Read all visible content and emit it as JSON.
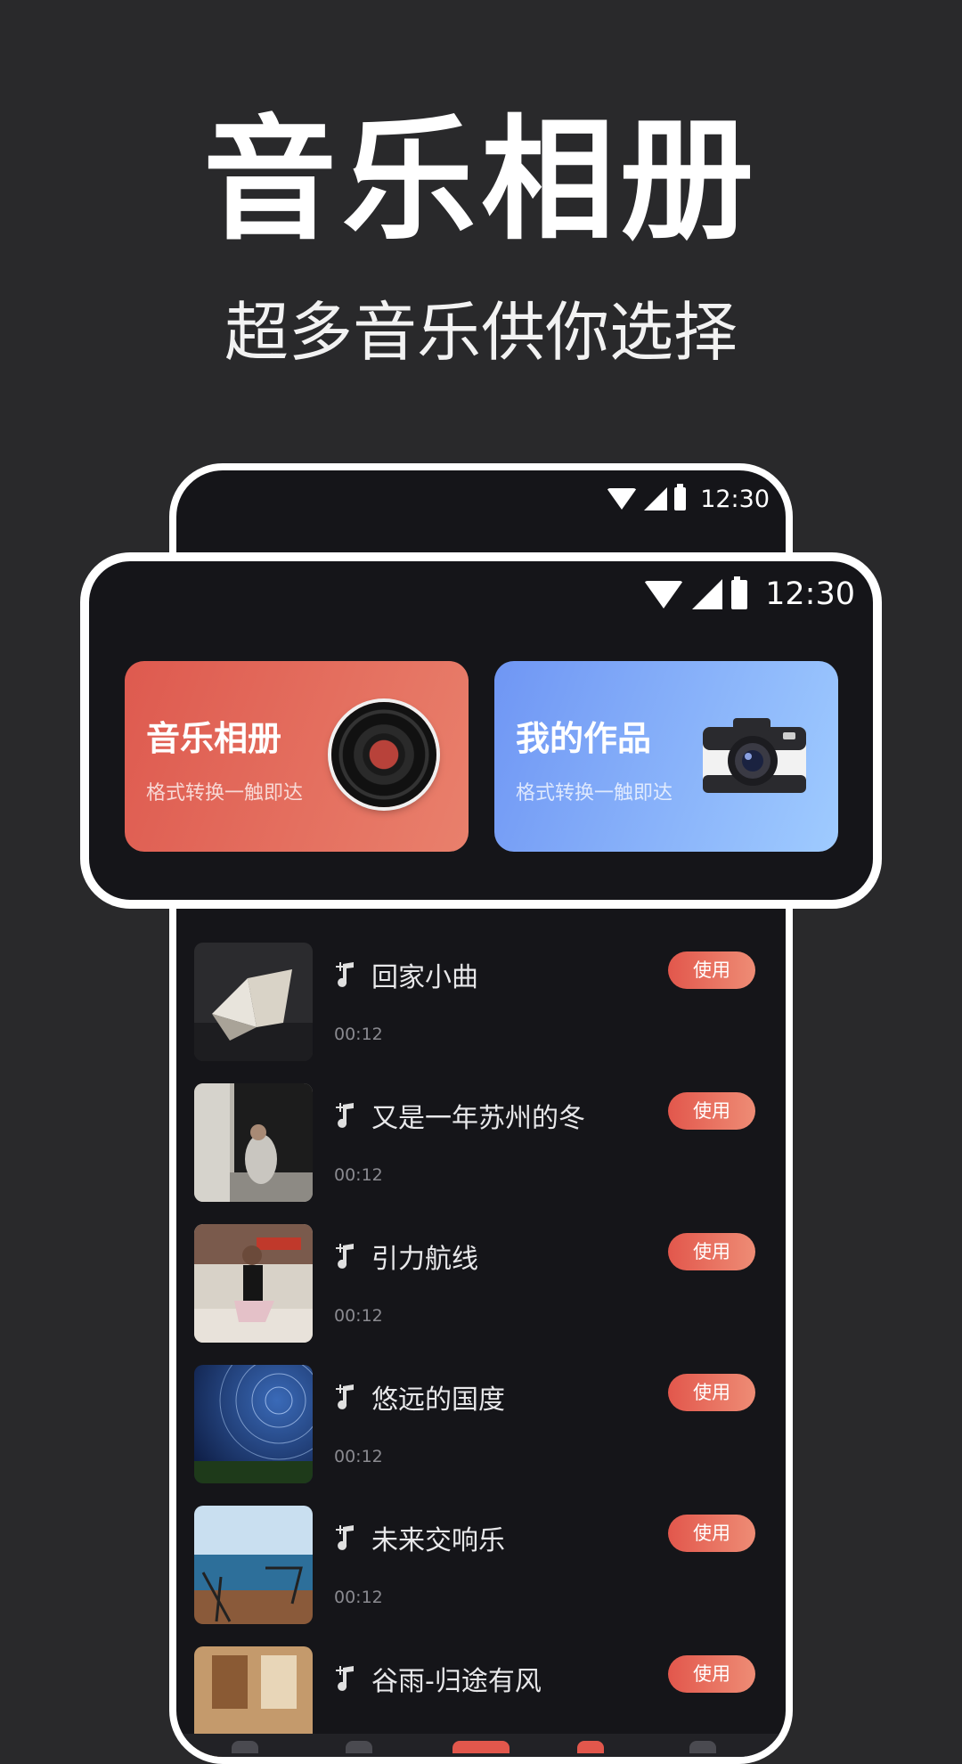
{
  "headline": "音乐相册",
  "subheadline": "超多音乐供你选择",
  "status_bar": {
    "time": "12:30"
  },
  "cards": [
    {
      "title": "音乐相册",
      "subtitle": "格式转换一触即达",
      "color": "#e25b50",
      "icon": "vinyl-record-icon"
    },
    {
      "title": "我的作品",
      "subtitle": "格式转换一触即达",
      "color": "#7aa2f7",
      "icon": "camera-icon"
    }
  ],
  "songs": [
    {
      "title": "回家小曲",
      "duration": "00:12",
      "action": "使用"
    },
    {
      "title": "又是一年苏州的冬",
      "duration": "00:12",
      "action": "使用"
    },
    {
      "title": "引力航线",
      "duration": "00:12",
      "action": "使用"
    },
    {
      "title": "悠远的国度",
      "duration": "00:12",
      "action": "使用"
    },
    {
      "title": "未来交响乐",
      "duration": "00:12",
      "action": "使用"
    },
    {
      "title": "谷雨-归途有风",
      "duration": "",
      "action": "使用"
    }
  ],
  "colors": {
    "background": "#29292b",
    "phone_screen": "#151519",
    "accent_red": "#e2574c",
    "accent_blue": "#7aa2f7"
  }
}
